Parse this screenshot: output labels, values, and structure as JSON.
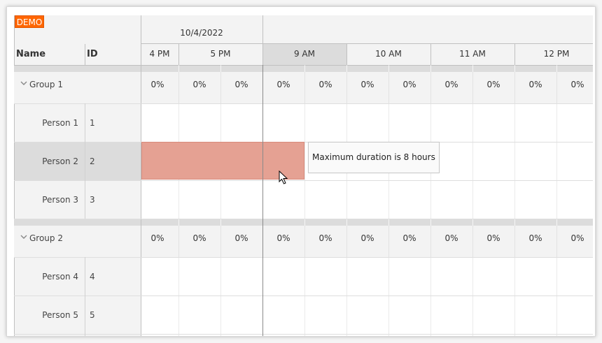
{
  "badge": "DEMO",
  "header": {
    "date": "10/4/2022",
    "name_col": "Name",
    "id_col": "ID",
    "hours": [
      "4 PM",
      "5 PM",
      "9 AM",
      "10 AM",
      "11 AM",
      "12 PM"
    ],
    "highlighted_hour": "9 AM"
  },
  "groups": [
    {
      "label": "Group 1",
      "load": [
        "0%",
        "0%",
        "0%",
        "0%",
        "0%",
        "0%",
        "0%",
        "0%",
        "0%",
        "0%",
        "0%"
      ],
      "people": [
        {
          "name": "Person 1",
          "id": "1"
        },
        {
          "name": "Person 2",
          "id": "2"
        },
        {
          "name": "Person 3",
          "id": "3"
        }
      ]
    },
    {
      "label": "Group 2",
      "load": [
        "0%",
        "0%",
        "0%",
        "0%",
        "0%",
        "0%",
        "0%",
        "0%",
        "0%",
        "0%",
        "0%"
      ],
      "people": [
        {
          "name": "Person 4",
          "id": "4"
        },
        {
          "name": "Person 5",
          "id": "5"
        }
      ]
    }
  ],
  "tooltip": "Maximum duration is 8 hours",
  "colors": {
    "badge": "#ff6600",
    "event": "#e5a193",
    "header": "#f3f3f3",
    "selected_row": "#dcdcdc"
  }
}
